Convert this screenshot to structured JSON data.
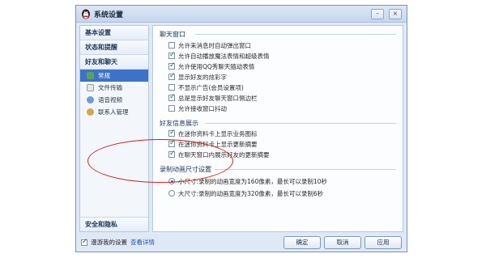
{
  "window": {
    "title": "系统设置",
    "minimize_label": "–",
    "close_label": "×"
  },
  "sidebar": {
    "groups": [
      {
        "label": "基本设置"
      },
      {
        "label": "状态和提醒"
      },
      {
        "label": "好友和聊天"
      }
    ],
    "items": [
      {
        "label": "常规",
        "icon": "general-icon",
        "selected": true
      },
      {
        "label": "文件传输",
        "icon": "file-transfer-icon",
        "selected": false
      },
      {
        "label": "语音视频",
        "icon": "voice-video-icon",
        "selected": false
      },
      {
        "label": "联系人管理",
        "icon": "contacts-icon",
        "selected": false
      }
    ],
    "bottom_group": {
      "label": "安全和隐私"
    }
  },
  "sections": {
    "chat_window": {
      "title": "聊天窗口",
      "options": [
        {
          "label": "允许来消息时自动弹出窗口",
          "checked": false
        },
        {
          "label": "允许自动播放魔法表情和超级表情",
          "checked": true
        },
        {
          "label": "允许使用QQ秀聊天随动表情",
          "checked": true
        },
        {
          "label": "显示好友的炫彩字",
          "checked": true
        },
        {
          "label": "不显示广告(会员设置项)",
          "checked": false
        },
        {
          "label": "总是显示好友聊天窗口侧边栏",
          "checked": true
        },
        {
          "label": "允许接收窗口抖动",
          "checked": false
        }
      ]
    },
    "friend_info": {
      "title": "好友信息展示",
      "options": [
        {
          "label": "在迷你资料卡上显示业务图标",
          "checked": true
        },
        {
          "label": "在迷你资料卡上显示更新摘要",
          "checked": true
        },
        {
          "label": "在聊天窗口内展示好友的更新摘要",
          "checked": true
        }
      ]
    },
    "recording": {
      "title": "录制动画尺寸设置",
      "options": [
        {
          "label": "小尺寸:录制的动画宽度为160像素，最长可以录制10秒",
          "selected": true
        },
        {
          "label": "大尺寸:录制的动画宽度为320像素，最长可以录制6秒",
          "selected": false
        }
      ]
    }
  },
  "footer": {
    "roam_label": "漫游我的设置",
    "roam_checked": true,
    "details_link": "查看详情",
    "ok_label": "确定",
    "cancel_label": "取消",
    "apply_label": "应用"
  },
  "colors": {
    "accent": "#3c73c8",
    "highlight_ellipse": "#d21e1e",
    "check": "#1a7a1a"
  }
}
